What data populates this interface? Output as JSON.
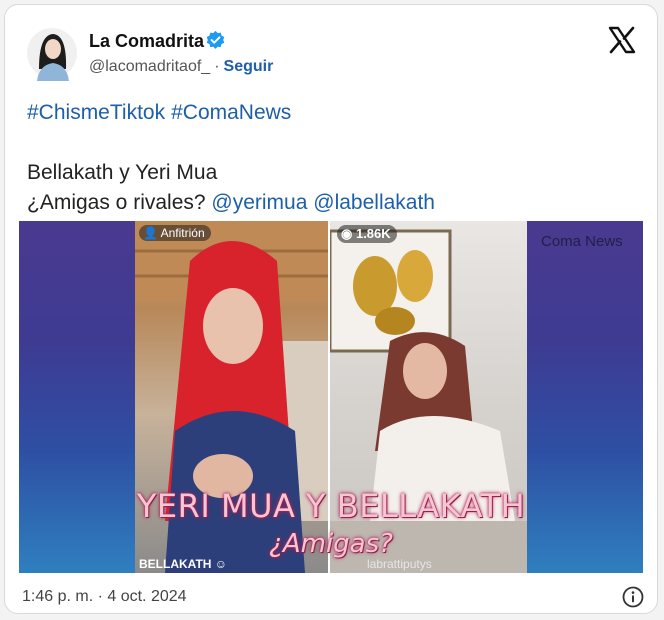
{
  "tweet": {
    "author_name": "La Comadrita",
    "handle": "@lacomadritaof_",
    "separator": "·",
    "follow_label": "Seguir",
    "hashtags": [
      "#ChismeTiktok",
      "#ComaNews"
    ],
    "body_line1": "Bellakath y Yeri Mua",
    "body_line2_prefix": "¿Amigas o rivales?",
    "mentions": [
      "@yerimua",
      "@labellakath"
    ],
    "timestamp": "1:46 p. m. · 4 oct. 2024"
  },
  "media": {
    "host_badge": "Anfitrión",
    "viewer_count": "1.86K",
    "watermark": "Coma News",
    "overlay_title": "YERI MUA Y BELLAKATH",
    "overlay_subtitle": "¿Amigas?",
    "caption_left": "BELLAKATH",
    "caption_right": "labrattiputys"
  },
  "colors": {
    "link": "#1d5fa8",
    "verified": "#1d9bf0",
    "overlay_text": "#f6c6d3"
  },
  "icons": [
    "avatar",
    "verified-badge-icon",
    "x-logo-icon",
    "info-icon",
    "person-icon",
    "eye-icon",
    "emoji-icon"
  ]
}
